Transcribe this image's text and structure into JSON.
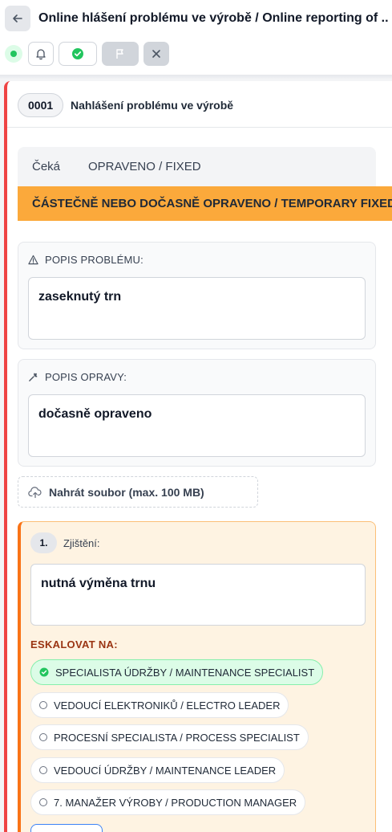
{
  "header": {
    "title": "Online hlášení problému ve výrobě / Online reporting of ..."
  },
  "toolbar": {
    "status_color": "#22c55e"
  },
  "card": {
    "id": "0001",
    "title": "Nahlášení problému ve výrobě",
    "accent_color": "#ef4444"
  },
  "status": {
    "waiting": "Čeká",
    "fixed": "OPRAVENO / FIXED",
    "current": "ČÁSTEČNĚ NEBO DOČASNĚ OPRAVENO / TEMPORARY FIXED",
    "current_color": "#fba93b"
  },
  "problem": {
    "label": "POPIS PROBLÉMU:",
    "value": "zaseknutý trn"
  },
  "repair": {
    "label": "POPIS OPRAVY:",
    "value": "dočasně opraveno"
  },
  "upload": {
    "label": "Nahrát soubor (max. 100 MB)"
  },
  "finding": {
    "number": "1.",
    "label": "Zjištění:",
    "value": "nutná výměna trnu",
    "escalate_label": "ESKALOVAT NA:",
    "options": [
      {
        "label": "SPECIALISTA ÚDRŽBY / MAINTENANCE SPECIALIST",
        "selected": true
      },
      {
        "label": "VEDOUCÍ ELEKTRONIKŮ / ELECTRO LEADER",
        "selected": false
      },
      {
        "label": "PROCESNÍ SPECIALISTA / PROCESS SPECIALIST",
        "selected": false
      },
      {
        "label": "VEDOUCÍ ÚDRŽBY / MAINTENANCE LEADER",
        "selected": false
      },
      {
        "label": "7. MANAŽER VÝROBY / PRODUCTION MANAGER",
        "selected": false
      }
    ]
  }
}
